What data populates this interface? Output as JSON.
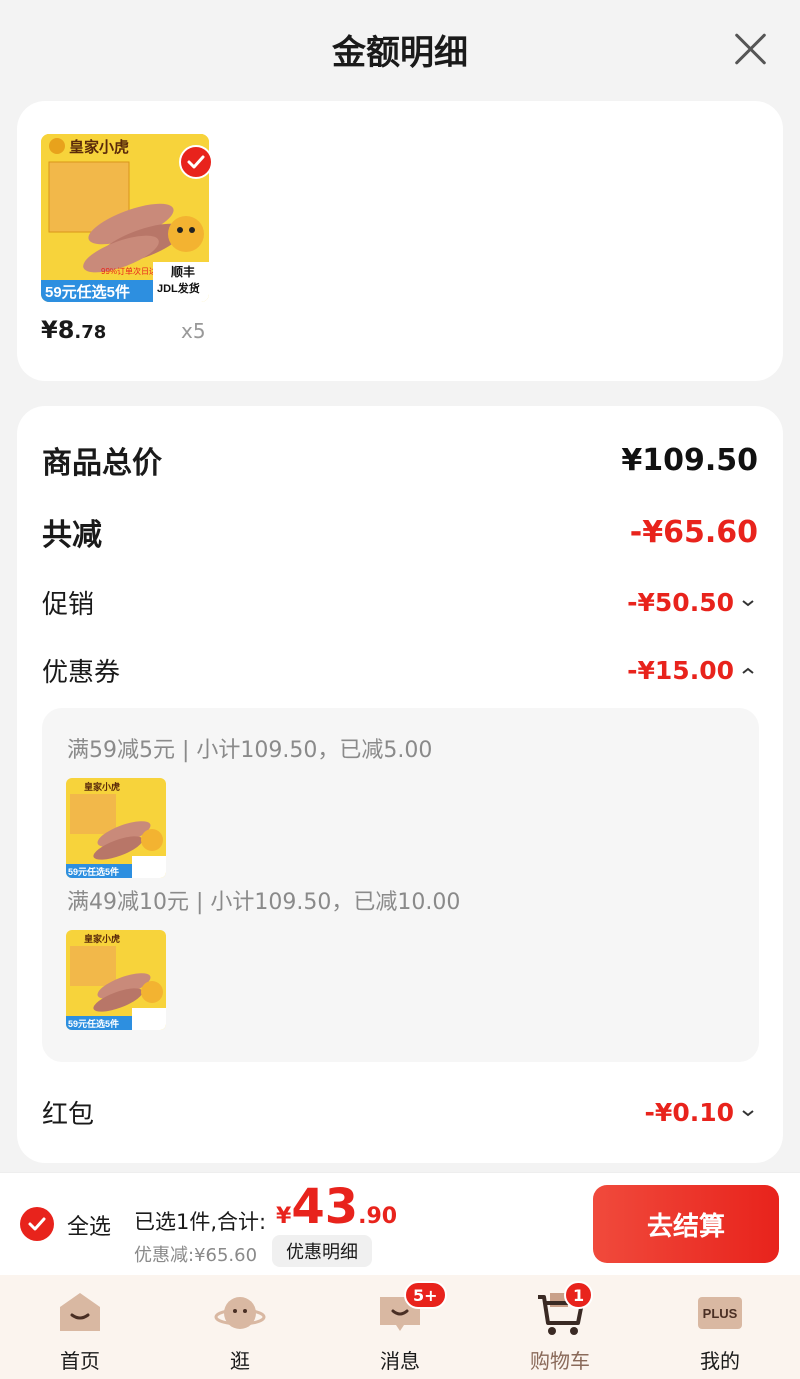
{
  "header": {
    "title": "金额明细"
  },
  "product": {
    "image_texts": {
      "brand": "皇家小虎",
      "promo": "59元任选5件",
      "note": "99%订单次日达",
      "shipping1": "顺丰",
      "shipping2": "JDL发货"
    },
    "price_int": "¥8",
    "price_dec": ".78",
    "quantity": "x5"
  },
  "summary": {
    "total_label": "商品总价",
    "total_value": "¥109.50",
    "discount_label": "共减",
    "discount_value": "-¥65.60",
    "promo_label": "促销",
    "promo_value": "-¥50.50",
    "coupon_label": "优惠券",
    "coupon_value": "-¥15.00",
    "coupons": [
      {
        "text": "满59减5元 | 小计109.50，已减5.00"
      },
      {
        "text": "满49减10元 | 小计109.50，已减10.00"
      }
    ],
    "redpacket_label": "红包",
    "redpacket_value": "-¥0.10"
  },
  "checkout": {
    "select_all": "全选",
    "selected_text": "已选1件,合计:",
    "total_yen": "¥",
    "total_int": "43",
    "total_dec": ".90",
    "discount_text": "优惠减:¥65.60",
    "detail_chip": "优惠明细",
    "button": "去结算"
  },
  "tabs": [
    {
      "label": "首页",
      "icon": "home-icon"
    },
    {
      "label": "逛",
      "icon": "planet-icon"
    },
    {
      "label": "消息",
      "icon": "message-icon",
      "badge": "5+"
    },
    {
      "label": "购物车",
      "icon": "cart-icon",
      "badge": "1",
      "active": true
    },
    {
      "label": "我的",
      "icon": "plus-member-icon",
      "icon_text": "PLUS"
    }
  ],
  "colors": {
    "accent": "#e8231c",
    "tabbar_bg": "#fbf4ee"
  }
}
